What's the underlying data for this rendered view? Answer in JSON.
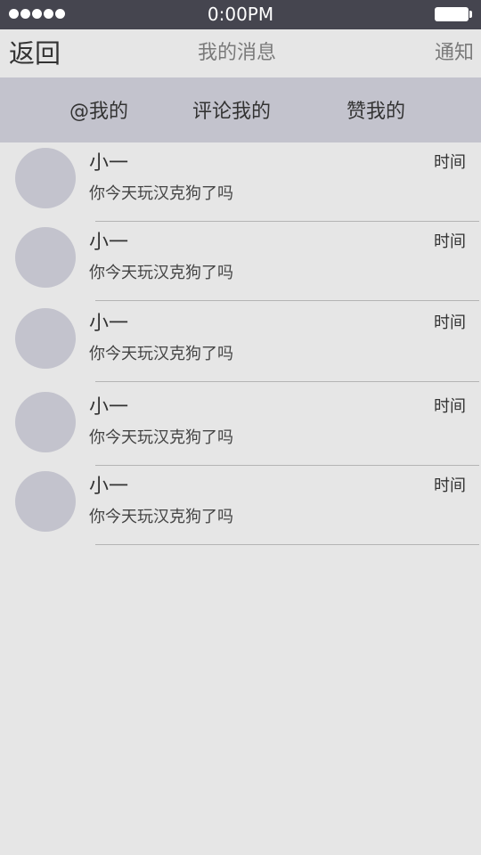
{
  "status_bar": {
    "time": "0:00PM",
    "signal_icon": "signal-dots-icon",
    "battery_icon": "battery-icon"
  },
  "nav": {
    "back_label": "返回",
    "title": "我的消息",
    "notify_label": "通知"
  },
  "tabs": [
    {
      "label": "@我的"
    },
    {
      "label": "评论我的"
    },
    {
      "label": "赞我的"
    }
  ],
  "messages": [
    {
      "name": "小一",
      "time": "时间",
      "text": "你今天玩汉克狗了吗"
    },
    {
      "name": "小一",
      "time": "时间",
      "text": "你今天玩汉克狗了吗"
    },
    {
      "name": "小一",
      "time": "时间",
      "text": "你今天玩汉克狗了吗"
    },
    {
      "name": "小一",
      "time": "时间",
      "text": "你今天玩汉克狗了吗"
    },
    {
      "name": "小一",
      "time": "时间",
      "text": "你今天玩汉克狗了吗"
    }
  ],
  "colors": {
    "status_bar_bg": "#45454f",
    "background": "#e6e6e6",
    "tab_bar_bg": "#c3c3cd",
    "avatar_placeholder": "#c3c3cd"
  }
}
